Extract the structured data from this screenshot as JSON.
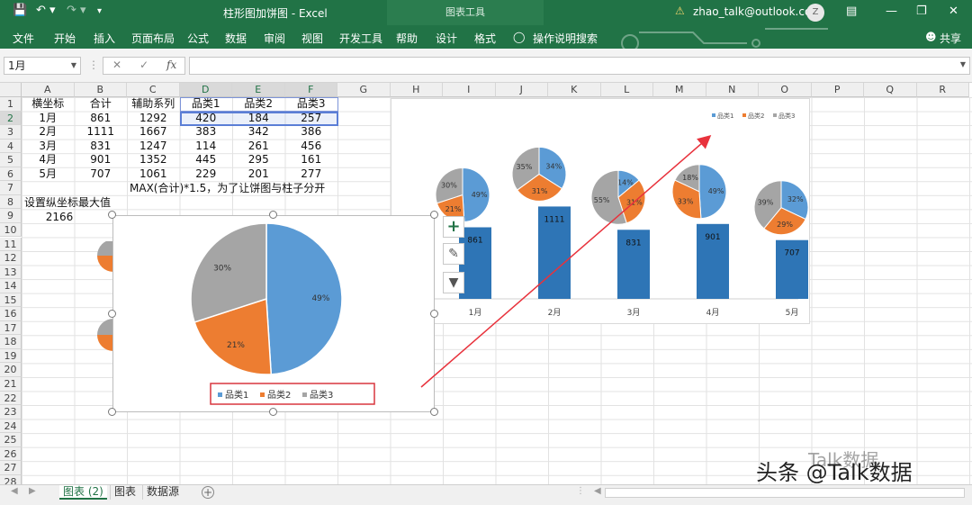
{
  "titlebar": {
    "doc_title": "柱形图加饼图 - Excel",
    "context_tab": "图表工具",
    "user_email": "zhao_talk@outlook.com",
    "avatar_letter": "Z"
  },
  "ribbon": {
    "tabs": [
      "文件",
      "开始",
      "插入",
      "页面布局",
      "公式",
      "数据",
      "审阅",
      "视图",
      "开发工具",
      "帮助",
      "设计",
      "格式"
    ],
    "tell_me": "操作说明搜索",
    "share": "共享"
  },
  "formula_bar": {
    "name_box": "1月",
    "formula": ""
  },
  "columns": [
    "A",
    "B",
    "C",
    "D",
    "E",
    "F",
    "G",
    "H",
    "I",
    "J",
    "K",
    "L",
    "M",
    "N",
    "O",
    "P",
    "Q",
    "R"
  ],
  "rows": [
    "1",
    "2",
    "3",
    "4",
    "5",
    "6",
    "7",
    "8",
    "9",
    "10",
    "11",
    "12",
    "13",
    "14",
    "15",
    "16",
    "17",
    "18",
    "19",
    "20",
    "21",
    "22",
    "23",
    "24",
    "25",
    "26",
    "27",
    "28"
  ],
  "table": {
    "header": [
      "横坐标",
      "合计",
      "辅助系列",
      "品类1",
      "品类2",
      "品类3"
    ],
    "rows": [
      [
        "1月",
        "861",
        "1292",
        "420",
        "184",
        "257"
      ],
      [
        "2月",
        "1111",
        "1667",
        "383",
        "342",
        "386"
      ],
      [
        "3月",
        "831",
        "1247",
        "114",
        "261",
        "456"
      ],
      [
        "4月",
        "901",
        "1352",
        "445",
        "295",
        "161"
      ],
      [
        "5月",
        "707",
        "1061",
        "229",
        "201",
        "277"
      ]
    ]
  },
  "notes": {
    "c7": "MAX(合计)*1.5，为了让饼图与柱子分开",
    "a8": "设置纵坐标最大值",
    "a9": "2166"
  },
  "chart_data": [
    {
      "type": "bar",
      "categories": [
        "1月",
        "2月",
        "3月",
        "4月",
        "5月"
      ],
      "values": [
        861,
        1111,
        831,
        901,
        707
      ],
      "legend": [
        "品类1",
        "品类2",
        "品类3"
      ],
      "legend_position": "top-right",
      "pies": [
        {
          "category": "1月",
          "percents": [
            "49%",
            "21%",
            "30%"
          ]
        },
        {
          "category": "2月",
          "percents": [
            "34%",
            "31%",
            "35%"
          ]
        },
        {
          "category": "3月",
          "percents": [
            "14%",
            "31%",
            "55%"
          ]
        },
        {
          "category": "4月",
          "percents": [
            "49%",
            "33%",
            "18%"
          ]
        },
        {
          "category": "5月",
          "percents": [
            "32%",
            "29%",
            "39%"
          ]
        }
      ]
    },
    {
      "type": "pie",
      "series": [
        {
          "name": "品类1",
          "value": 49,
          "label": "49%"
        },
        {
          "name": "品类2",
          "value": 21,
          "label": "21%"
        },
        {
          "name": "品类3",
          "value": 30,
          "label": "30%"
        }
      ],
      "legend": [
        "品类1",
        "品类2",
        "品类3"
      ],
      "legend_position": "bottom"
    }
  ],
  "colors": {
    "excel_green": "#217346",
    "cat1": "#5b9bd5",
    "cat2": "#ed7d31",
    "cat3": "#a5a5a5",
    "bar": "#2e75b6",
    "arrow": "#e8323c"
  },
  "sheets": [
    "图表 (2)",
    "图表",
    "数据源"
  ],
  "watermark": {
    "main": "头条 @Talk数据",
    "faint": "Talk数据"
  }
}
